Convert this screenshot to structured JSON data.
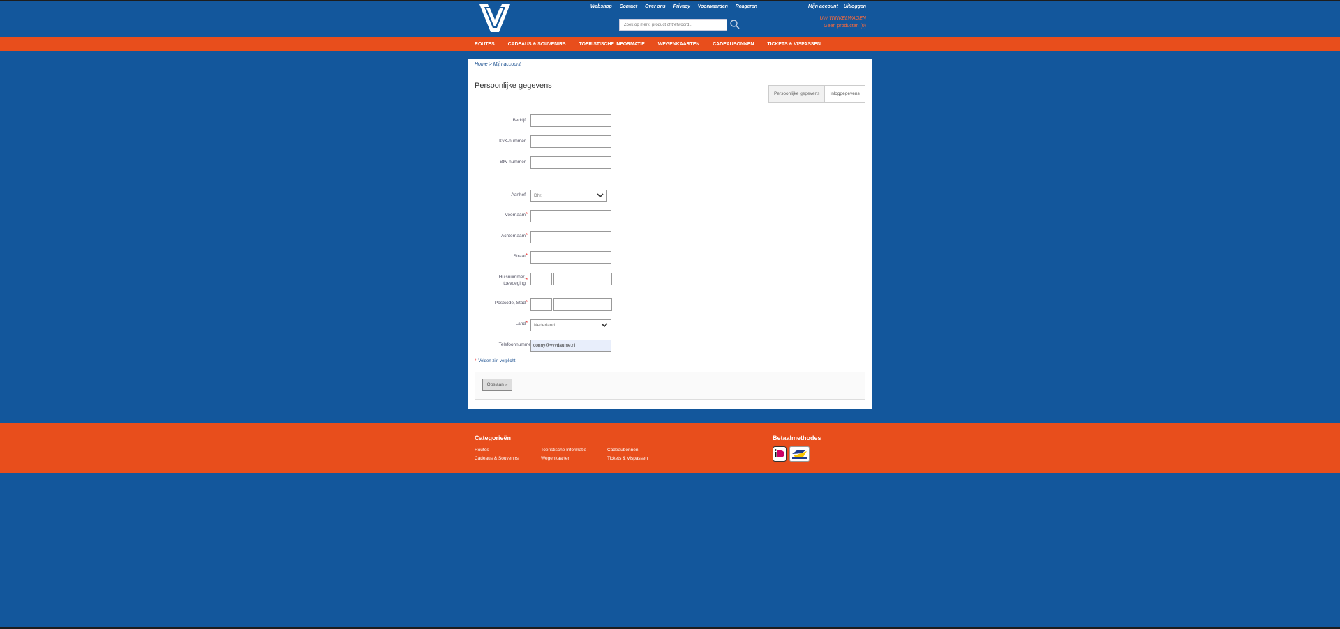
{
  "header": {
    "topnav": [
      "Webshop",
      "Contact",
      "Over ons",
      "Privacy",
      "Voorwaarden",
      "Reageren"
    ],
    "search_placeholder": "Zoek op merk, product of trefwoord...",
    "account": [
      "Mijn account",
      "Uitloggen"
    ],
    "cart_title": "UW WINKELWAGEN",
    "cart_count": "Geen producten (0)"
  },
  "mainnav": [
    "ROUTES",
    "CADEAUS & SOUVENIRS",
    "TOERISTISCHE INFORMATIE",
    "WEGENKAARTEN",
    "CADEAUBONNEN",
    "TICKETS & VISPASSEN"
  ],
  "breadcrumb": {
    "home": "Home",
    "sep": " > ",
    "current": "Mijn account"
  },
  "page_title": "Persoonlijke gegevens",
  "tabs": [
    "Persoonlijke gegevens",
    "Inloggegevens"
  ],
  "form": {
    "bedrijf": "Bedrijf",
    "kvk": "KvK-nummer",
    "btw": "Btw-nummer",
    "aanhef": "Aanhef",
    "aanhef_value": "Dhr.",
    "voornaam": "Voornaam",
    "achternaam": "Achternaam",
    "straat": "Straat",
    "huisnummer": "Huisnummer, toevoeging",
    "postcode": "Postcode, Stad",
    "land": "Land",
    "land_value": "Nederland",
    "telefoon": "Telefoonnummer",
    "telefoon_value": "conny@vvvdaume.nl",
    "required_note": "Velden zijn verplicht",
    "save": "Opslaan »"
  },
  "footer": {
    "categories_title": "Categorieën",
    "links": [
      "Routes",
      "Cadeaus & Souvenirs",
      "Toeristische Informatie",
      "Wegenkaarten",
      "Cadeaubonnen",
      "Tickets & Vispassen"
    ],
    "payment_title": "Betaalmethodes",
    "payment_icons": [
      "ideal-icon",
      "bancontact-icon"
    ]
  },
  "colors": {
    "blue": "#13579c",
    "orange": "#e84e1c"
  }
}
